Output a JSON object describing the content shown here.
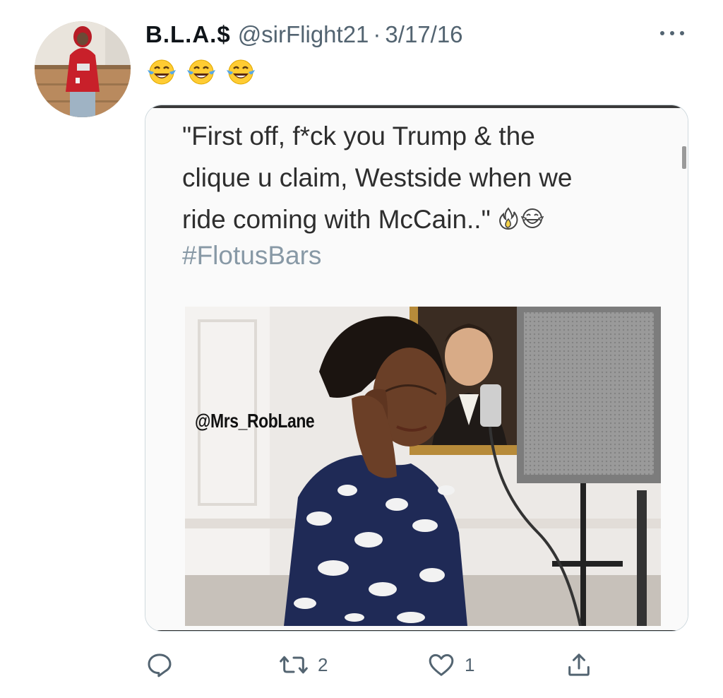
{
  "tweet": {
    "display_name": "B.L.A.$",
    "handle": "@sirFlight21",
    "separator": "·",
    "date": "3/17/16",
    "text_emojis": [
      "face-with-tears-of-joy",
      "face-with-tears-of-joy",
      "face-with-tears-of-joy"
    ],
    "colors": {
      "text": "#0f1419",
      "secondary": "#536471",
      "card_border": "#cfd9de"
    }
  },
  "media": {
    "quote_text": "\"First off, f*ck you Trump & the\nclique u claim, Westside when we\nride coming with McCain..\"",
    "quote_emojis": [
      "fire",
      "face-with-tears-of-joy"
    ],
    "hashtag": "#FlotusBars",
    "hashtag_color": "#8899a6",
    "watermark": "@Mrs_RobLane"
  },
  "actions": {
    "reply": {
      "icon": "reply-icon",
      "count": ""
    },
    "retweet": {
      "icon": "retweet-icon",
      "count": "2"
    },
    "like": {
      "icon": "heart-icon",
      "count": "1"
    },
    "share": {
      "icon": "share-icon",
      "count": ""
    }
  }
}
